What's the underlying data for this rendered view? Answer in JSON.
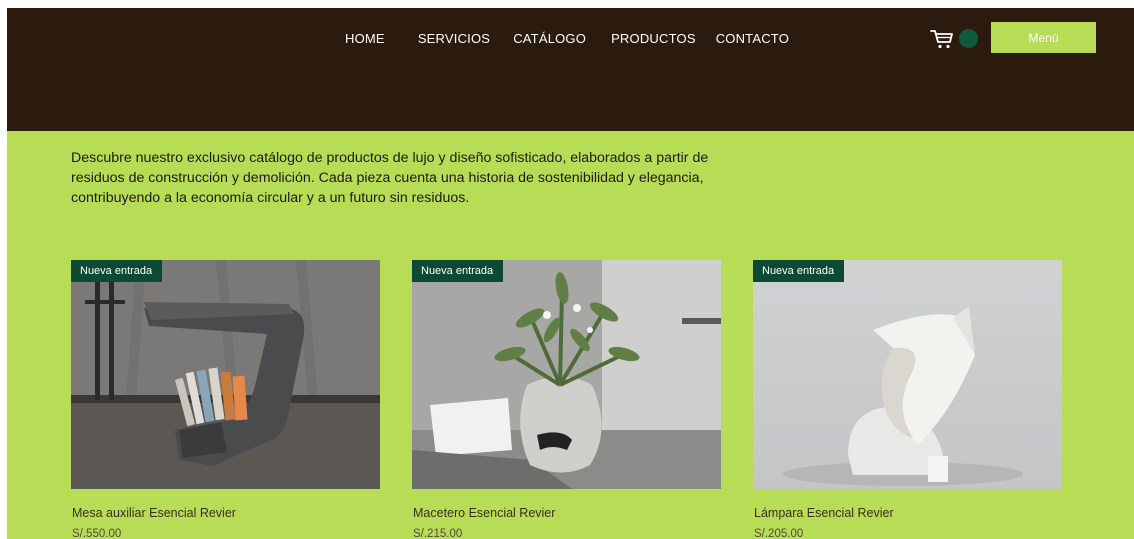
{
  "nav": {
    "items": [
      "HOME",
      "SERVICIOS",
      "CATÁLOGO",
      "PRODUCTOS",
      "CONTACTO"
    ],
    "menu_label": "Menú"
  },
  "intro": {
    "text": "Descubre nuestro exclusivo catálogo de productos de lujo y diseño sofisticado, elaborados a partir de residuos de construcción y demolición. Cada pieza cuenta una historia de sostenibilidad y elegancia, contribuyendo a la economía circular y a un futuro sin residuos."
  },
  "products": [
    {
      "badge": "Nueva entrada",
      "name": "Mesa auxiliar Esencial Revier",
      "price": "S/.550.00"
    },
    {
      "badge": "Nueva entrada",
      "name": "Macetero Esencial Revier",
      "price": "S/.215.00"
    },
    {
      "badge": "Nueva entrada",
      "name": "Lámpara Esencial Revier",
      "price": "S/.205.00"
    }
  ],
  "colors": {
    "header_bg": "#2b1b0f",
    "page_bg": "#b7dc55",
    "badge_bg": "#0d4a35",
    "cart_badge": "#0e5a3c"
  },
  "icons": {
    "cart": "shopping-cart-icon"
  }
}
